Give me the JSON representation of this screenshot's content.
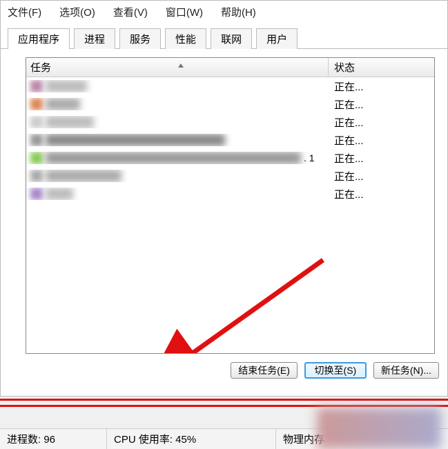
{
  "menu": {
    "file": "文件(F)",
    "options": "选项(O)",
    "view": "查看(V)",
    "window": "窗口(W)",
    "help": "帮助(H)"
  },
  "tabs": {
    "applications": "应用程序",
    "processes": "进程",
    "services": "服务",
    "performance": "性能",
    "networking": "联网",
    "users": "用户"
  },
  "columns": {
    "task": "任务",
    "status": "状态"
  },
  "rows": [
    {
      "status": "正在..."
    },
    {
      "status": "正在..."
    },
    {
      "status": "正在..."
    },
    {
      "status": "正在..."
    },
    {
      "status": "正在...",
      "suffix": ". 1"
    },
    {
      "status": "正在..."
    },
    {
      "status": "正在..."
    }
  ],
  "buttons": {
    "end_task": "结束任务(E)",
    "switch_to": "切换至(S)",
    "new_task": "新任务(N)..."
  },
  "statusbar": {
    "processes": "进程数: 96",
    "cpu": "CPU 使用率: 45%",
    "memory": "物理内存"
  }
}
